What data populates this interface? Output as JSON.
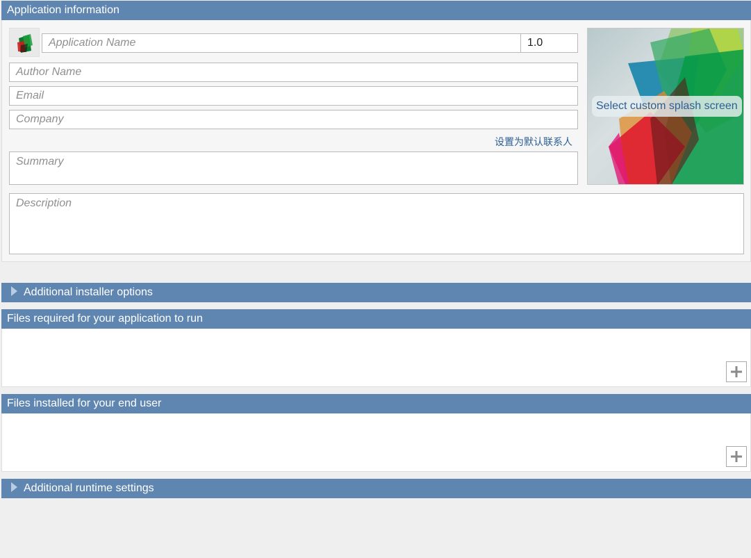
{
  "app_info": {
    "header": "Application information",
    "app_name": {
      "value": "",
      "placeholder": "Application Name"
    },
    "version": "1.0",
    "author": {
      "value": "",
      "placeholder": "Author Name"
    },
    "email": {
      "value": "",
      "placeholder": "Email"
    },
    "company": {
      "value": "",
      "placeholder": "Company"
    },
    "set_default_contact": "设置为默认联系人",
    "summary": {
      "value": "",
      "placeholder": "Summary"
    },
    "description": {
      "value": "",
      "placeholder": "Description"
    },
    "splash_label": "Select custom splash screen",
    "app_icon": "matlab-app-icon"
  },
  "sections": {
    "installer_options": "Additional installer options",
    "files_required": "Files required for your application to run",
    "files_installed": "Files installed for your end user",
    "runtime_settings": "Additional runtime settings"
  },
  "icons": {
    "add": "plus-icon",
    "expand": "triangle-right-icon"
  },
  "colors": {
    "header_bg": "#5f86b0",
    "link": "#2c5f93"
  }
}
